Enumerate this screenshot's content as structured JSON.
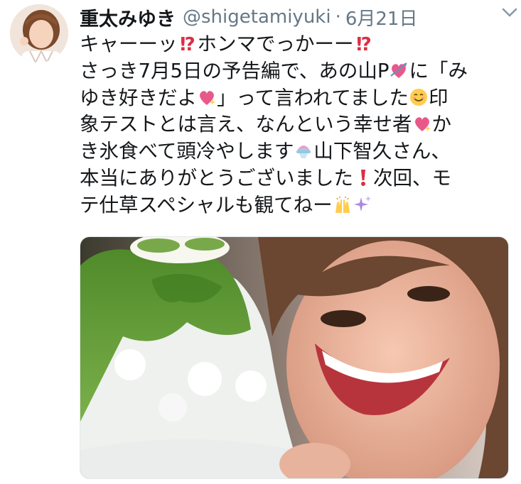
{
  "tweet": {
    "display_name": "重太みゆき",
    "handle": "@shigetamiyuki",
    "separator": "·",
    "date": "6月21日",
    "lines": [
      [
        {
          "t": "text",
          "v": "キャーーッ"
        },
        {
          "t": "emoji",
          "v": "interrobang-icon"
        },
        {
          "t": "text",
          "v": "ホンマでっかーー"
        },
        {
          "t": "emoji",
          "v": "interrobang-icon"
        }
      ],
      [
        {
          "t": "text",
          "v": "さっき7月5日の予告編で、あの山P"
        },
        {
          "t": "emoji",
          "v": "heart-arrow-icon"
        },
        {
          "t": "text",
          "v": "に「み"
        }
      ],
      [
        {
          "t": "text",
          "v": "ゆき好きだよ"
        },
        {
          "t": "emoji",
          "v": "sparkling-heart-icon"
        },
        {
          "t": "text",
          "v": "」って言われてました"
        },
        {
          "t": "emoji",
          "v": "smiling-face-icon"
        },
        {
          "t": "text",
          "v": "印"
        }
      ],
      [
        {
          "t": "text",
          "v": "象テストとは言え、なんという幸せ者"
        },
        {
          "t": "emoji",
          "v": "sparkling-heart-icon"
        },
        {
          "t": "text",
          "v": "か"
        }
      ],
      [
        {
          "t": "text",
          "v": "き氷食べて頭冷やします"
        },
        {
          "t": "emoji",
          "v": "shaved-ice-icon"
        },
        {
          "t": "text",
          "v": "山下智久さん、"
        }
      ],
      [
        {
          "t": "text",
          "v": "本当にありがとうございました"
        },
        {
          "t": "emoji",
          "v": "exclamation-icon"
        },
        {
          "t": "text",
          "v": "次回、モ"
        }
      ],
      [
        {
          "t": "text",
          "v": "テ仕草スペシャルも観てねー"
        },
        {
          "t": "emoji",
          "v": "raising-hands-icon"
        },
        {
          "t": "emoji",
          "v": "sparkles-icon"
        }
      ]
    ]
  },
  "colors": {
    "text": "#14171a",
    "secondary": "#657786",
    "interrobang": "#dd2e44",
    "heart": "#e8598a"
  },
  "media": {
    "kind": "photo",
    "subject_icon": "selfie-photo-icon"
  }
}
